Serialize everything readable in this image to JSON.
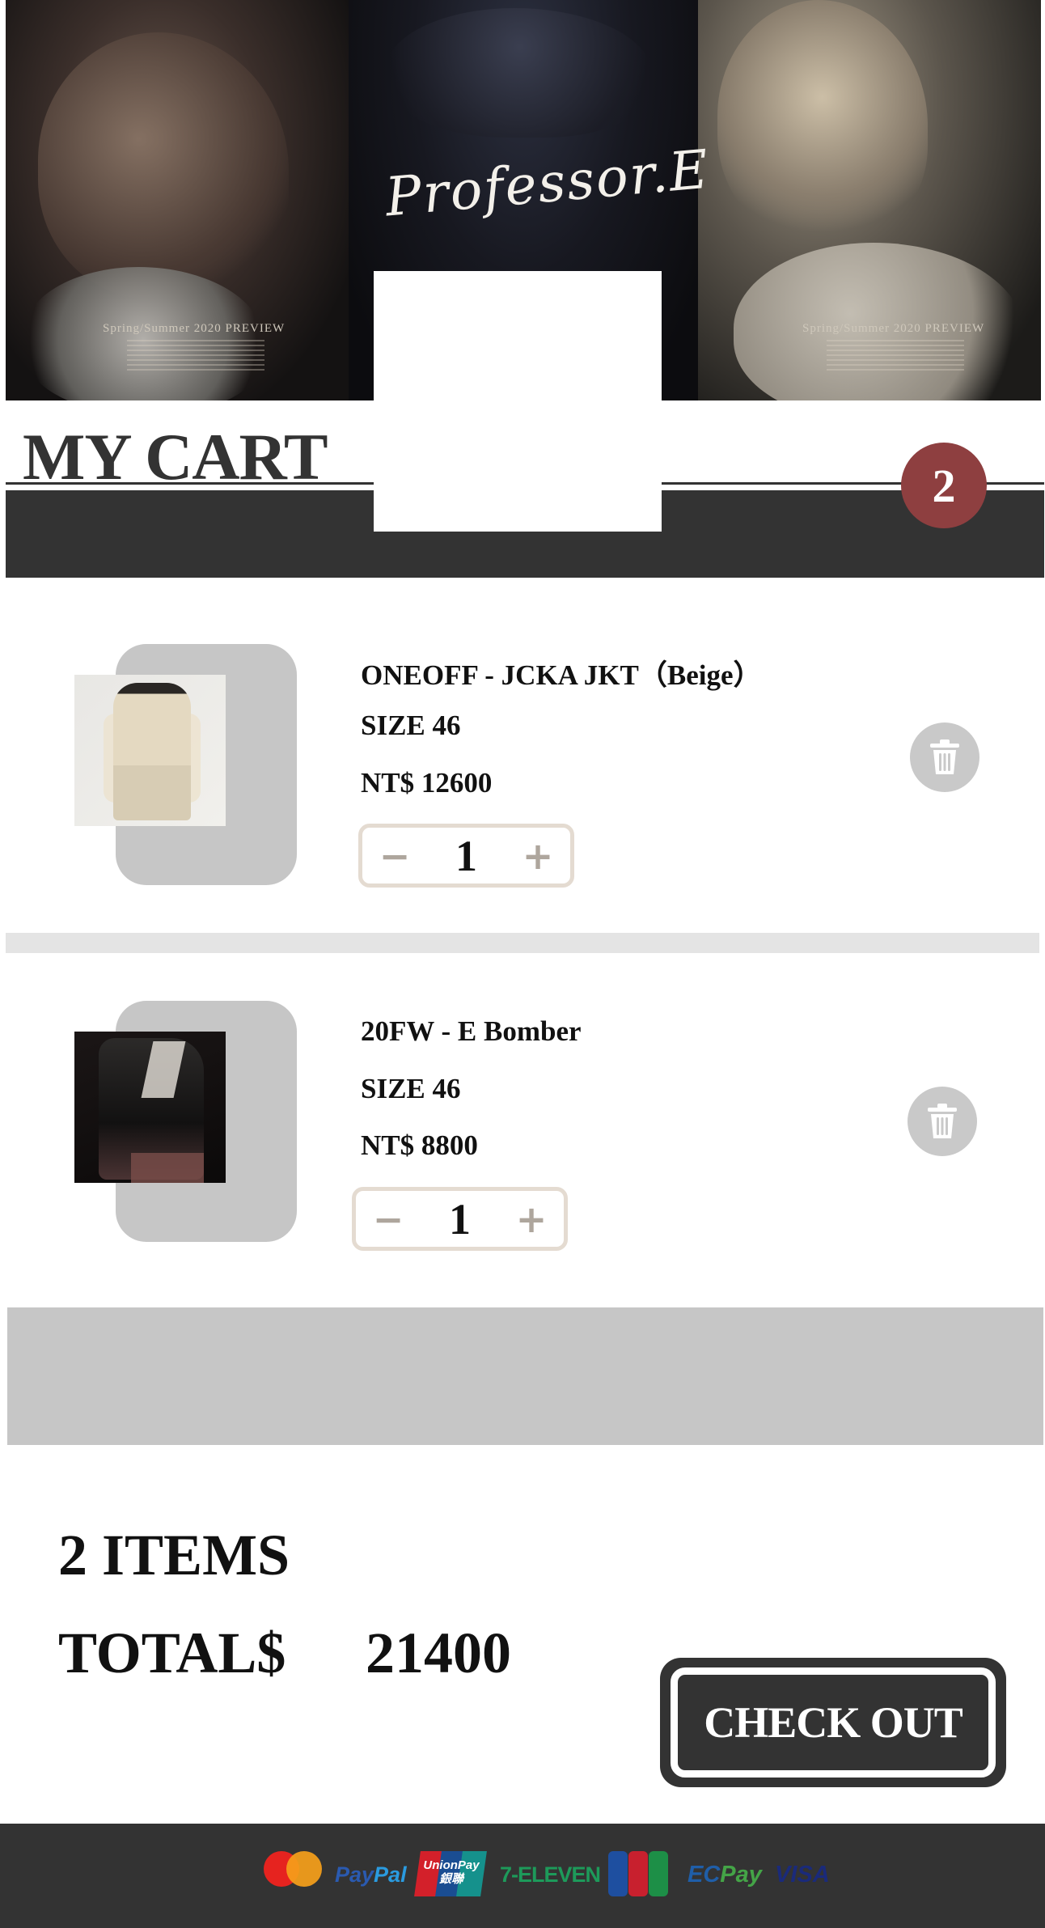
{
  "hero": {
    "logo_text": "Professor.E",
    "season_left": "Spring/Summer 2020 PREVIEW",
    "season_right": "Spring/Summer 2020 PREVIEW"
  },
  "cart": {
    "title": "MY CART",
    "count_badge": "2"
  },
  "items": [
    {
      "name": "ONEOFF - JCKA JKT（Beige）",
      "size": "SIZE 46",
      "price": "NT$ 12600",
      "quantity": "1",
      "minus_symbol": "−",
      "plus_symbol": "+"
    },
    {
      "name": "20FW - E Bomber",
      "size": "SIZE 46",
      "price": "NT$ 8800",
      "quantity": "1",
      "minus_symbol": "−",
      "plus_symbol": "+"
    }
  ],
  "summary": {
    "items_label": "2 ITEMS",
    "total_label": "TOTAL$",
    "total_value": "21400"
  },
  "checkout": {
    "label": "CHECK OUT"
  },
  "footer": {
    "payment_methods": [
      "mastercard",
      "PayPal",
      "UnionPay",
      "7-ELEVEN",
      "JCB",
      "ECPay",
      "VISA"
    ],
    "paypal_a": "Pay",
    "paypal_b": "Pal",
    "unionpay": "UnionPay 銀聯",
    "seven_eleven": "7-ELEVEN",
    "ecpay_a": "EC",
    "ecpay_b": "Pay",
    "visa": "VISA"
  },
  "colors": {
    "dark": "#333333",
    "badge": "#8e3f40",
    "thumb_bg": "#c6c6c6",
    "stepper_border": "#e4dbd1"
  }
}
